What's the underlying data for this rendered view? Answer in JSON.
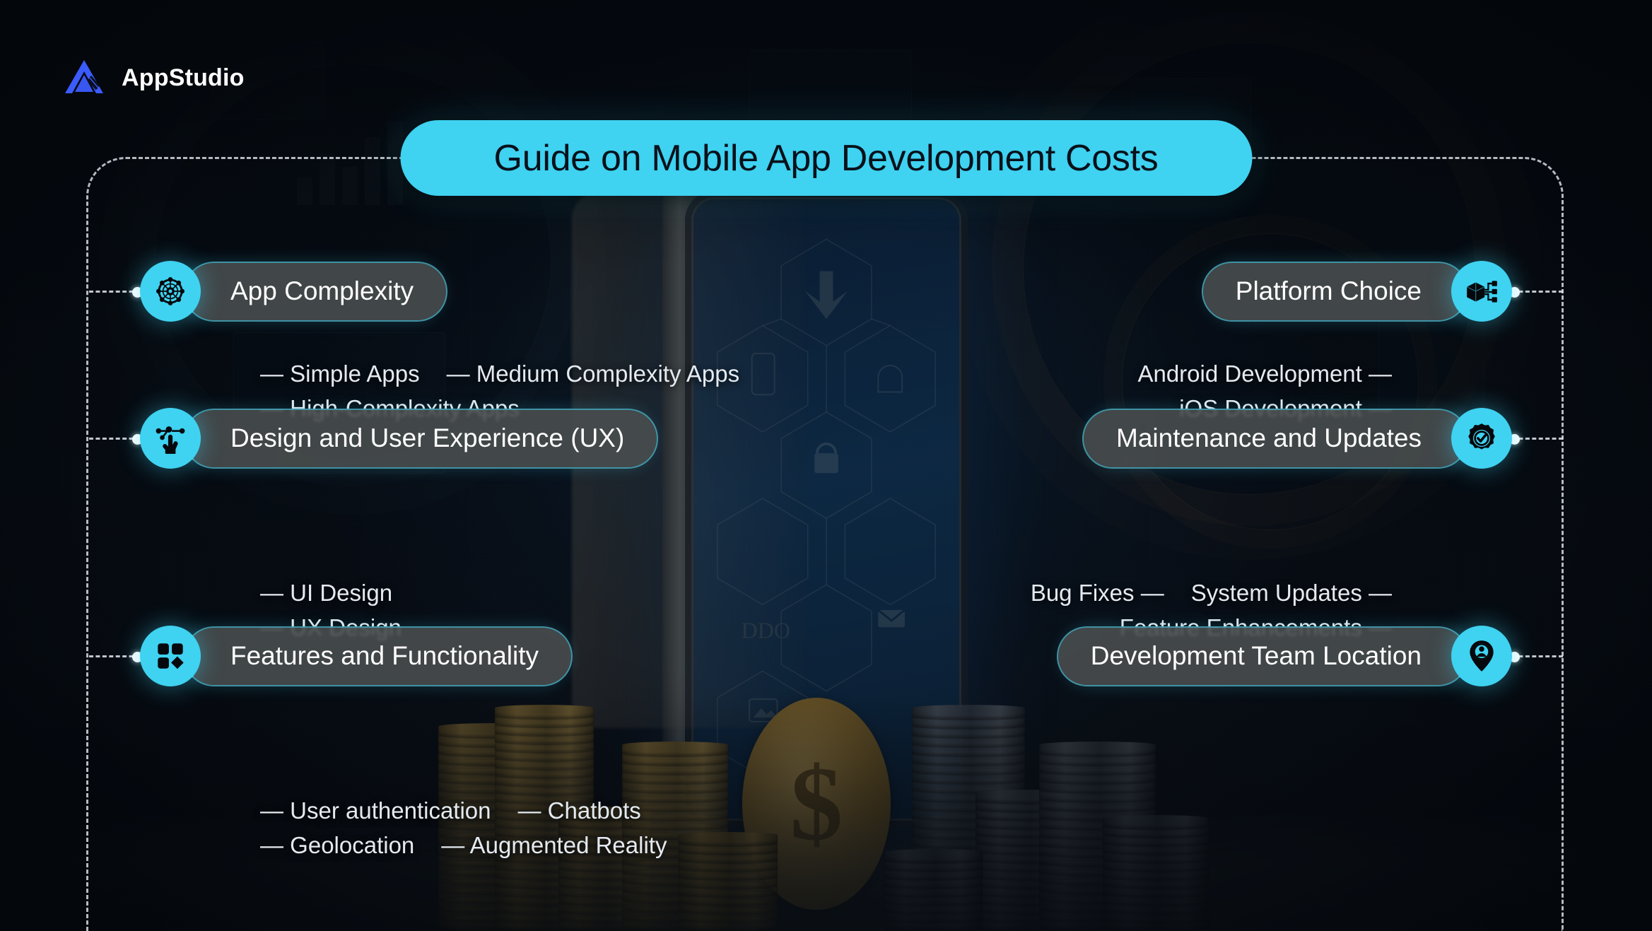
{
  "brand": {
    "name": "AppStudio",
    "logo_icon": "appstudio-triangle-logo",
    "accent": "#3fd2f1",
    "logo_color": "#3b5bfd"
  },
  "title": {
    "text": "Guide on Mobile App Development Costs",
    "bg_color": "#3fd2f1",
    "text_color": "#08111a"
  },
  "left_sections": [
    {
      "id": "app-complexity",
      "label": "App Complexity",
      "icon": "network-nodes-icon",
      "sub_lines": [
        [
          "— Simple Apps",
          "— Medium Complexity Apps"
        ],
        [
          "— High-Complexity Apps"
        ]
      ]
    },
    {
      "id": "design-ux",
      "label": "Design and User Experience (UX)",
      "icon": "touch-gesture-icon",
      "sub_lines": [
        [
          "— UI Design"
        ],
        [
          "— UX Design"
        ]
      ]
    },
    {
      "id": "features",
      "label": "Features and Functionality",
      "icon": "feature-grid-icon",
      "sub_lines": [
        [
          "— User authentication",
          "— Chatbots"
        ],
        [
          "— Geolocation",
          "— Augmented Reality"
        ]
      ]
    }
  ],
  "right_sections": [
    {
      "id": "platform-choice",
      "label": "Platform Choice",
      "icon": "cube-network-icon",
      "sub_lines": [
        [
          "Android Development —"
        ],
        [
          "iOS Development —"
        ]
      ]
    },
    {
      "id": "maintenance",
      "label": "Maintenance and Updates",
      "icon": "gear-check-icon",
      "sub_lines": [
        [
          "Bug Fixes —",
          "System Updates —"
        ],
        [
          "Feature Enhancements —"
        ]
      ]
    },
    {
      "id": "team-location",
      "label": "Development Team Location",
      "icon": "location-pin-person-icon",
      "sub_lines": []
    }
  ]
}
